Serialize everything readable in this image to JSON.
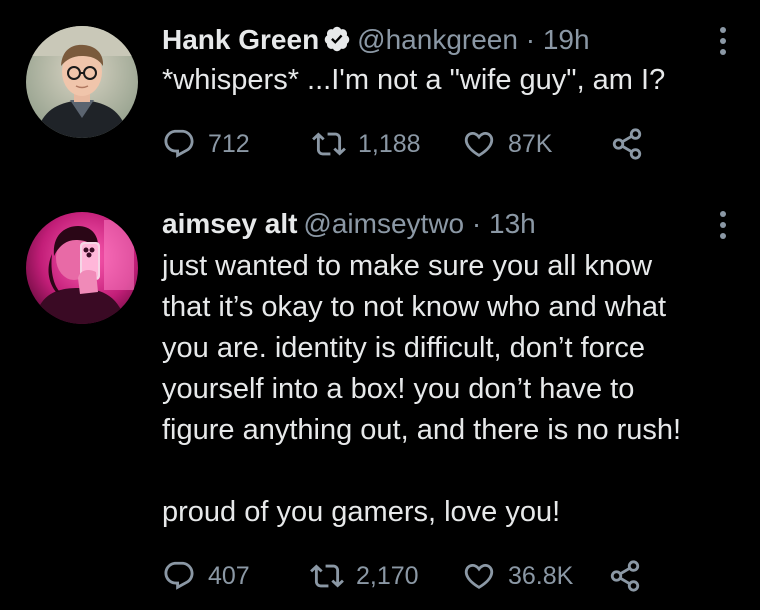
{
  "colors": {
    "background": "#000000",
    "text_primary": "#e7e9ea",
    "text_secondary": "#8b98a5",
    "verified_badge": "#e7e9ea"
  },
  "tweets": [
    {
      "display_name": "Hank Green",
      "verified": true,
      "handle": "@hankgreen",
      "separator": "·",
      "time": "19h",
      "text": "*whispers* ...I'm not a \"wife guy\", am I?",
      "avatar_icon": "avatar-photo-man-with-glasses",
      "more_icon": "more-options-icon",
      "actions": {
        "replies": "712",
        "retweets": "1,188",
        "likes": "87K"
      }
    },
    {
      "display_name": "aimsey alt",
      "verified": false,
      "handle": "@aimseytwo",
      "separator": "·",
      "time": "13h",
      "text": "just wanted to make sure you all know\nthat it’s okay to not know who and what\nyou are. identity is difficult, don’t force\nyourself into a box! you don’t have to\nfigure anything out, and there is no rush!\n\nproud of you gamers, love you!",
      "avatar_icon": "avatar-photo-pink-selfie",
      "more_icon": "more-options-icon",
      "actions": {
        "replies": "407",
        "retweets": "2,170",
        "likes": "36.8K"
      }
    }
  ]
}
